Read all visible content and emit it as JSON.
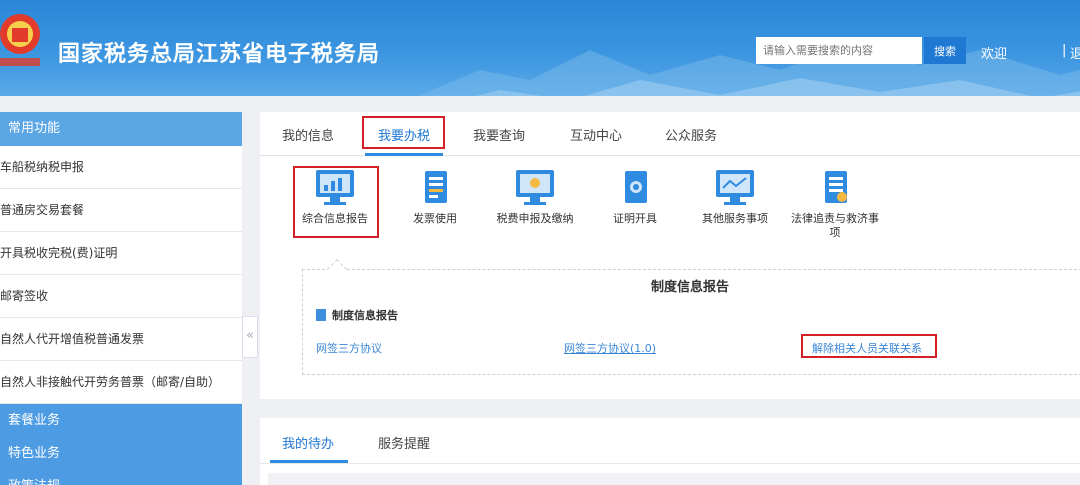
{
  "header": {
    "site_title": "国家税务总局江苏省电子税务局",
    "search_placeholder": "请输入需要搜索的内容",
    "search_button": "搜索",
    "welcome": "欢迎",
    "separator": "|",
    "extra": "退"
  },
  "sidebar": {
    "heading": "常用功能",
    "items": [
      {
        "label": "车船税纳税申报"
      },
      {
        "label": "普通房交易套餐"
      },
      {
        "label": "开具税收完税(费)证明"
      },
      {
        "label": "邮寄签收"
      },
      {
        "label": "自然人代开增值税普通发票"
      },
      {
        "label": "自然人非接触代开劳务普票（邮寄/自助）"
      }
    ],
    "categories": [
      {
        "label": "套餐业务"
      },
      {
        "label": "特色业务"
      },
      {
        "label": "政策法规"
      }
    ],
    "collapse_glyph": "«"
  },
  "main": {
    "tabs": [
      {
        "label": "我的信息"
      },
      {
        "label": "我要办税"
      },
      {
        "label": "我要查询"
      },
      {
        "label": "互动中心"
      },
      {
        "label": "公众服务"
      }
    ],
    "active_tab": "我要办税",
    "services": [
      {
        "label": "综合信息报告",
        "icon": "monitor-chart-icon"
      },
      {
        "label": "发票使用",
        "icon": "document-icon"
      },
      {
        "label": "税费申报及缴纳",
        "icon": "monitor-icon"
      },
      {
        "label": "证明开具",
        "icon": "certificate-icon"
      },
      {
        "label": "其他服务事项",
        "icon": "monitor-line-icon"
      },
      {
        "label": "法律追责与救济事项",
        "icon": "document-icon"
      }
    ],
    "info": {
      "title": "制度信息报告",
      "subtitle": "制度信息报告",
      "links": [
        {
          "label": "网签三方协议"
        },
        {
          "label": "网签三方协议(1.0)"
        },
        {
          "label": "解除相关人员关联关系"
        }
      ]
    }
  },
  "bottom": {
    "tabs": [
      {
        "label": "我的待办"
      },
      {
        "label": "服务提醒"
      }
    ]
  },
  "colors": {
    "header_blue": "#2a86d8",
    "accent_blue": "#1f78d2",
    "highlight_red": "#d32027",
    "sidebar_blue": "#5ba6e5"
  }
}
